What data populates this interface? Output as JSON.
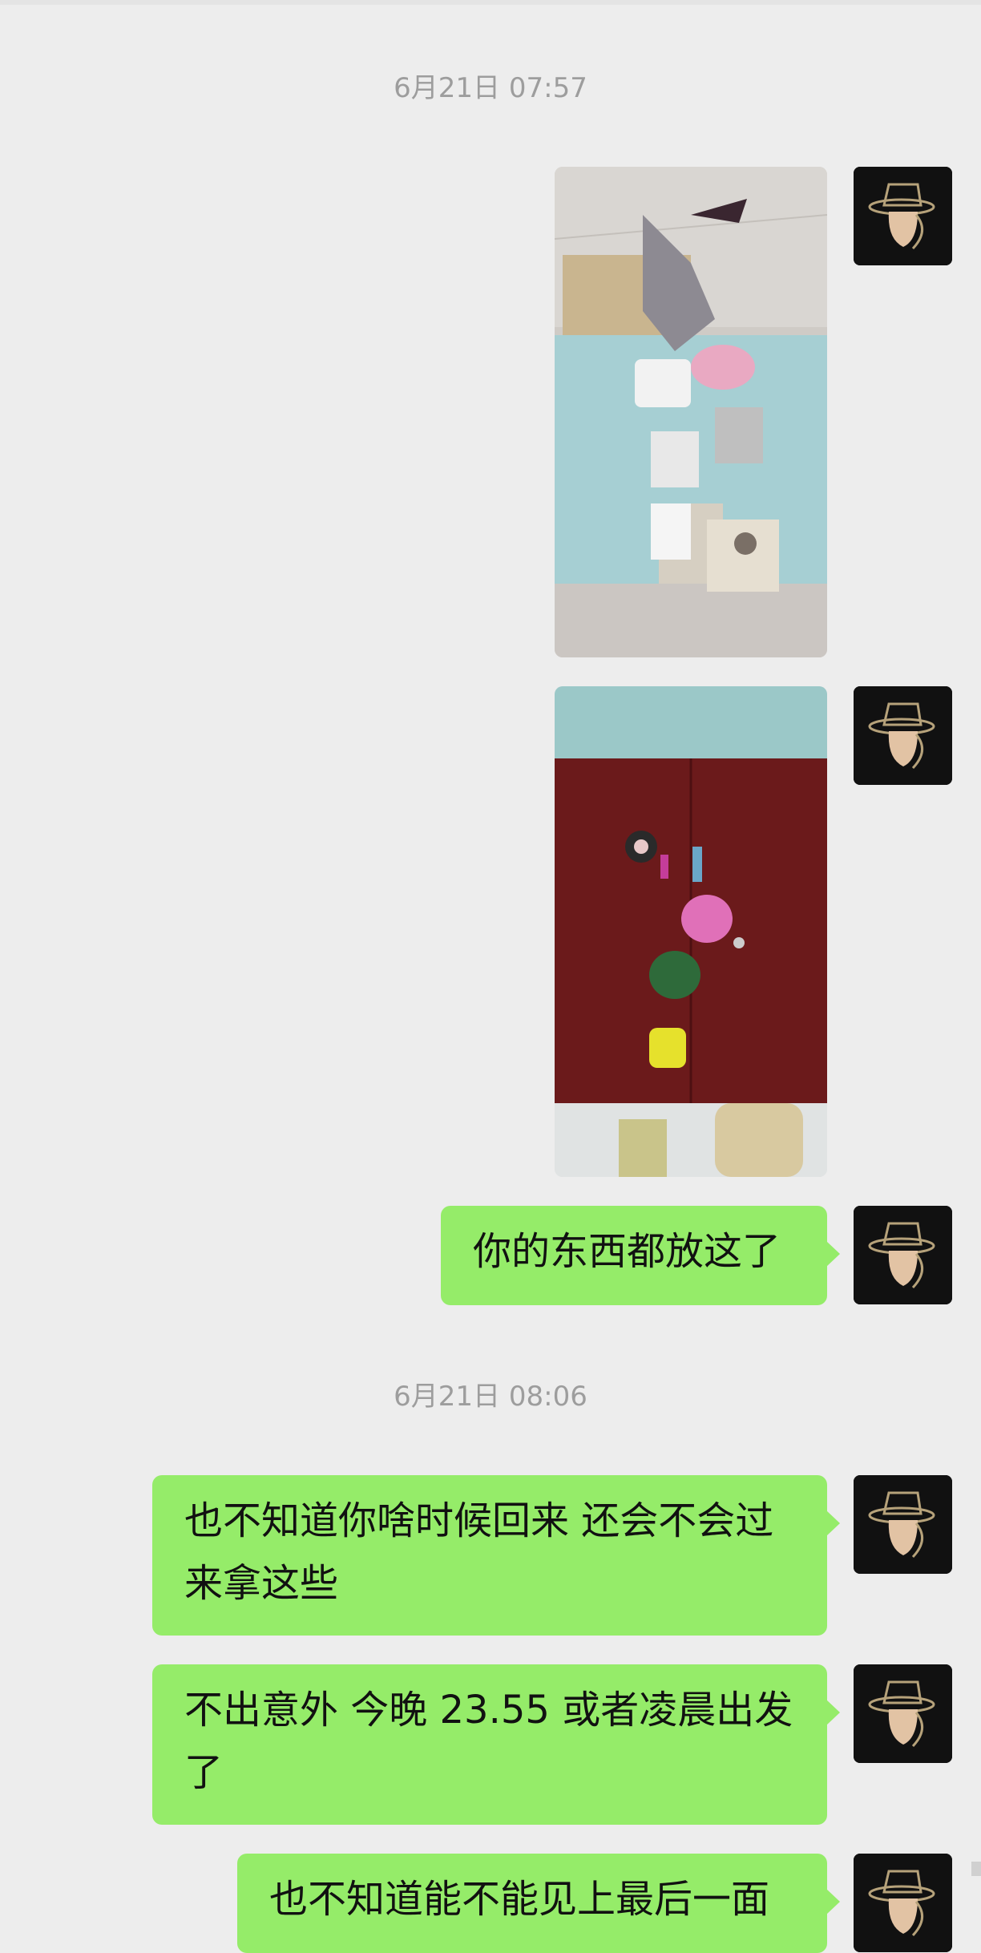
{
  "timestamps": [
    "6月21日 07:57",
    "6月21日 08:06"
  ],
  "messages": [
    {
      "type": "image",
      "description_icon": "photo-of-items-on-bed"
    },
    {
      "type": "image",
      "description_icon": "photo-of-items-on-red-table"
    },
    {
      "type": "text",
      "text": "你的东西都放这了"
    },
    {
      "type": "text",
      "text": "也不知道你啥时候回来 还会不会过来拿这些"
    },
    {
      "type": "text",
      "text": "不出意外 今晚 23.55 或者凌晨出发了"
    },
    {
      "type": "text",
      "text": "也不知道能不能见上最后一面"
    }
  ],
  "colors": {
    "background": "#ededed",
    "bubble_self": "#95ec69",
    "timestamp_text": "#9d9d9d",
    "avatar_bg": "#111111"
  },
  "icons": {
    "avatar": "hat-man-avatar-icon"
  }
}
